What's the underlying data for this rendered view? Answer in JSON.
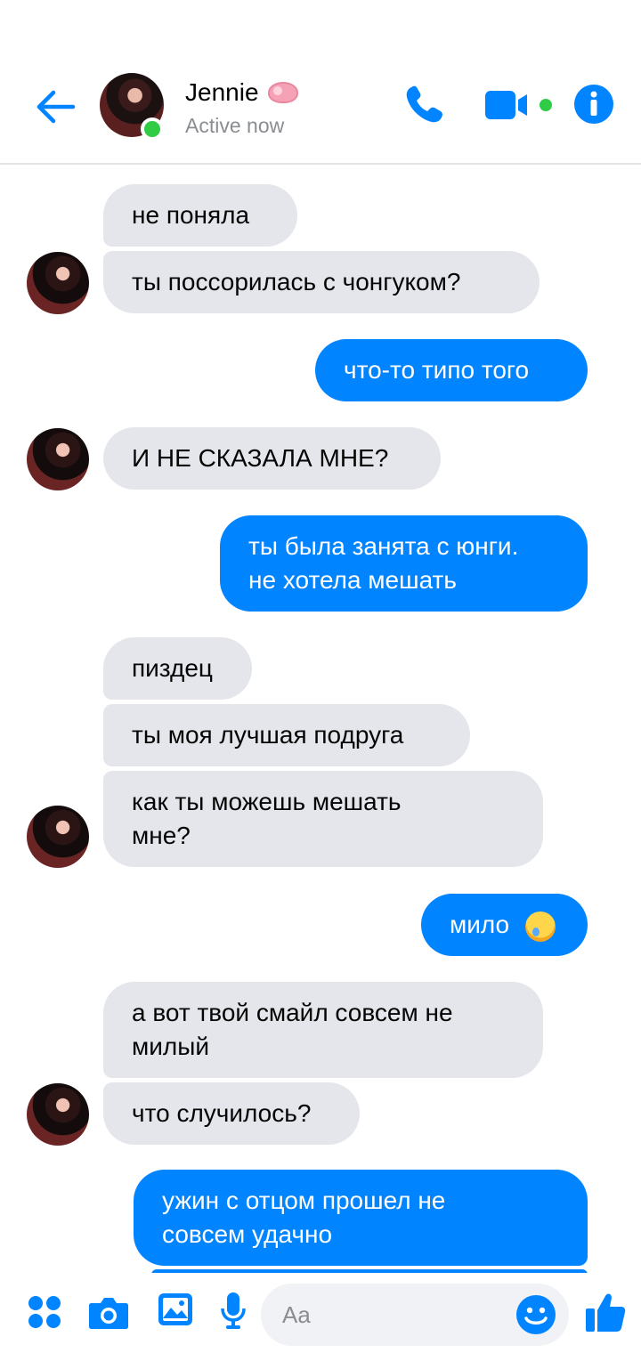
{
  "header": {
    "contact_name": "Jennie",
    "status": "Active now",
    "accent_color": "#0084ff",
    "icons": [
      "back-arrow-icon",
      "brain-emoji-icon",
      "phone-icon",
      "video-camera-icon",
      "info-icon"
    ]
  },
  "messages": [
    {
      "from": "them",
      "text": "не поняла"
    },
    {
      "from": "them",
      "text": "ты поссорилась с чонгуком?"
    },
    {
      "from": "me",
      "text": "что-то типо того"
    },
    {
      "from": "them",
      "text": "И НЕ СКАЗАЛА МНЕ?"
    },
    {
      "from": "me",
      "line1": "ты была занята с юнги.",
      "line2": "не хотела мешать"
    },
    {
      "from": "them",
      "text": "пиздец"
    },
    {
      "from": "them",
      "text": "ты моя лучшая подруга"
    },
    {
      "from": "them",
      "line1": "как ты можешь мешать",
      "line2": "мне?"
    },
    {
      "from": "me",
      "text": "мило",
      "emoji": "crying-face-emoji"
    },
    {
      "from": "them",
      "line1": "а вот твой смайл совсем не",
      "line2": "милый"
    },
    {
      "from": "them",
      "text": "что случилось?"
    },
    {
      "from": "me",
      "line1": "ужин с отцом прошел не",
      "line2": "совсем удачно"
    }
  ],
  "composer": {
    "placeholder": "Aa",
    "icons": [
      "apps-icon",
      "camera-icon",
      "gallery-icon",
      "microphone-icon",
      "emoji-smile-icon",
      "thumbs-up-icon"
    ]
  },
  "colors": {
    "incoming_bubble": "#e4e6eb",
    "outgoing_bubble": "#0084ff",
    "online_dot": "#31cc46"
  }
}
